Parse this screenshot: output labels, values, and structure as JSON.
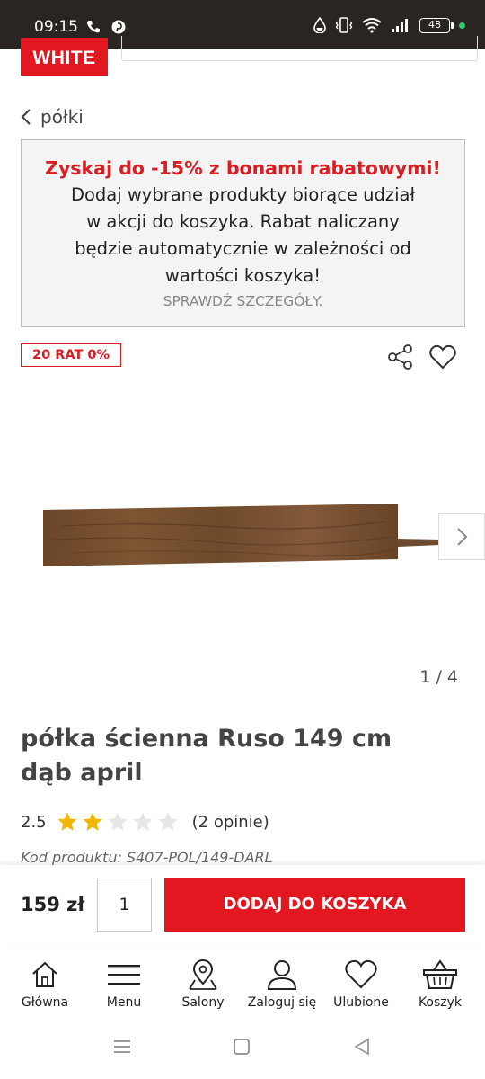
{
  "status_bar": {
    "time": "09:15",
    "battery": "48"
  },
  "brand": {
    "logo_text": "WHITE",
    "accent": "#e3171f"
  },
  "breadcrumb": {
    "back_label": "półki"
  },
  "promo": {
    "title": "Zyskaj do -15% z bonami rabatowymi!",
    "body": "Dodaj wybrane produkty biorące udział w akcji do koszyka. Rabat naliczany będzie automatycznie w zależności od wartości koszyka!",
    "link": "SPRAWDŹ SZCZEGÓŁY."
  },
  "badge": {
    "installments": "20 RAT 0%"
  },
  "gallery": {
    "pager": "1 / 4"
  },
  "product": {
    "title": "półka ścienna Ruso 149 cm dąb april",
    "rating": "2.5",
    "rating_max": 5,
    "reviews": "(2 opinie)",
    "code": "Kod produktu: S407-POL/149-DARL"
  },
  "buy": {
    "price": "159 zł",
    "quantity": "1",
    "add_button": "DODAJ DO KOSZYKA"
  },
  "bottom_nav": {
    "items": [
      {
        "label": "Główna",
        "icon": "home-icon"
      },
      {
        "label": "Menu",
        "icon": "menu-icon"
      },
      {
        "label": "Salony",
        "icon": "map-pin-icon"
      },
      {
        "label": "Zaloguj się",
        "icon": "user-icon"
      },
      {
        "label": "Ulubione",
        "icon": "heart-icon"
      },
      {
        "label": "Koszyk",
        "icon": "basket-icon"
      }
    ]
  }
}
